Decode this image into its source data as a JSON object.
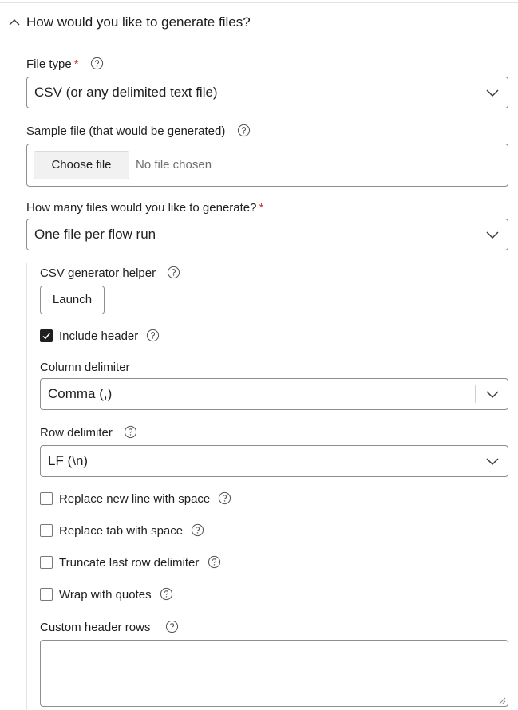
{
  "section": {
    "title": "How would you like to generate files?"
  },
  "file_type": {
    "label": "File type",
    "required_mark": "*",
    "value": "CSV (or any delimited text file)"
  },
  "sample_file": {
    "label": "Sample file (that would be generated)",
    "button": "Choose file",
    "status": "No file chosen"
  },
  "files_count": {
    "label": "How many files would you like to generate?",
    "required_mark": "*",
    "value": "One file per flow run"
  },
  "csv_helper": {
    "label": "CSV generator helper",
    "launch": "Launch"
  },
  "include_header": {
    "label": "Include header",
    "checked": true
  },
  "column_delimiter": {
    "label": "Column delimiter",
    "value": "Comma (,)"
  },
  "row_delimiter": {
    "label": "Row delimiter",
    "value": "LF (\\n)"
  },
  "options": [
    {
      "label": "Replace new line with space",
      "checked": false
    },
    {
      "label": "Replace tab with space",
      "checked": false
    },
    {
      "label": "Truncate last row delimiter",
      "checked": false
    },
    {
      "label": "Wrap with quotes",
      "checked": false
    }
  ],
  "custom_header_rows": {
    "label": "Custom header rows",
    "value": ""
  },
  "icons": {
    "collapse": "chevron-up-icon",
    "help": "help-circle-icon",
    "caret": "chevron-down-icon",
    "check": "checkmark-icon"
  },
  "colors": {
    "required": "#d32f2f",
    "border": "#8e8e8e",
    "checked_fill": "#1f1f1f"
  }
}
